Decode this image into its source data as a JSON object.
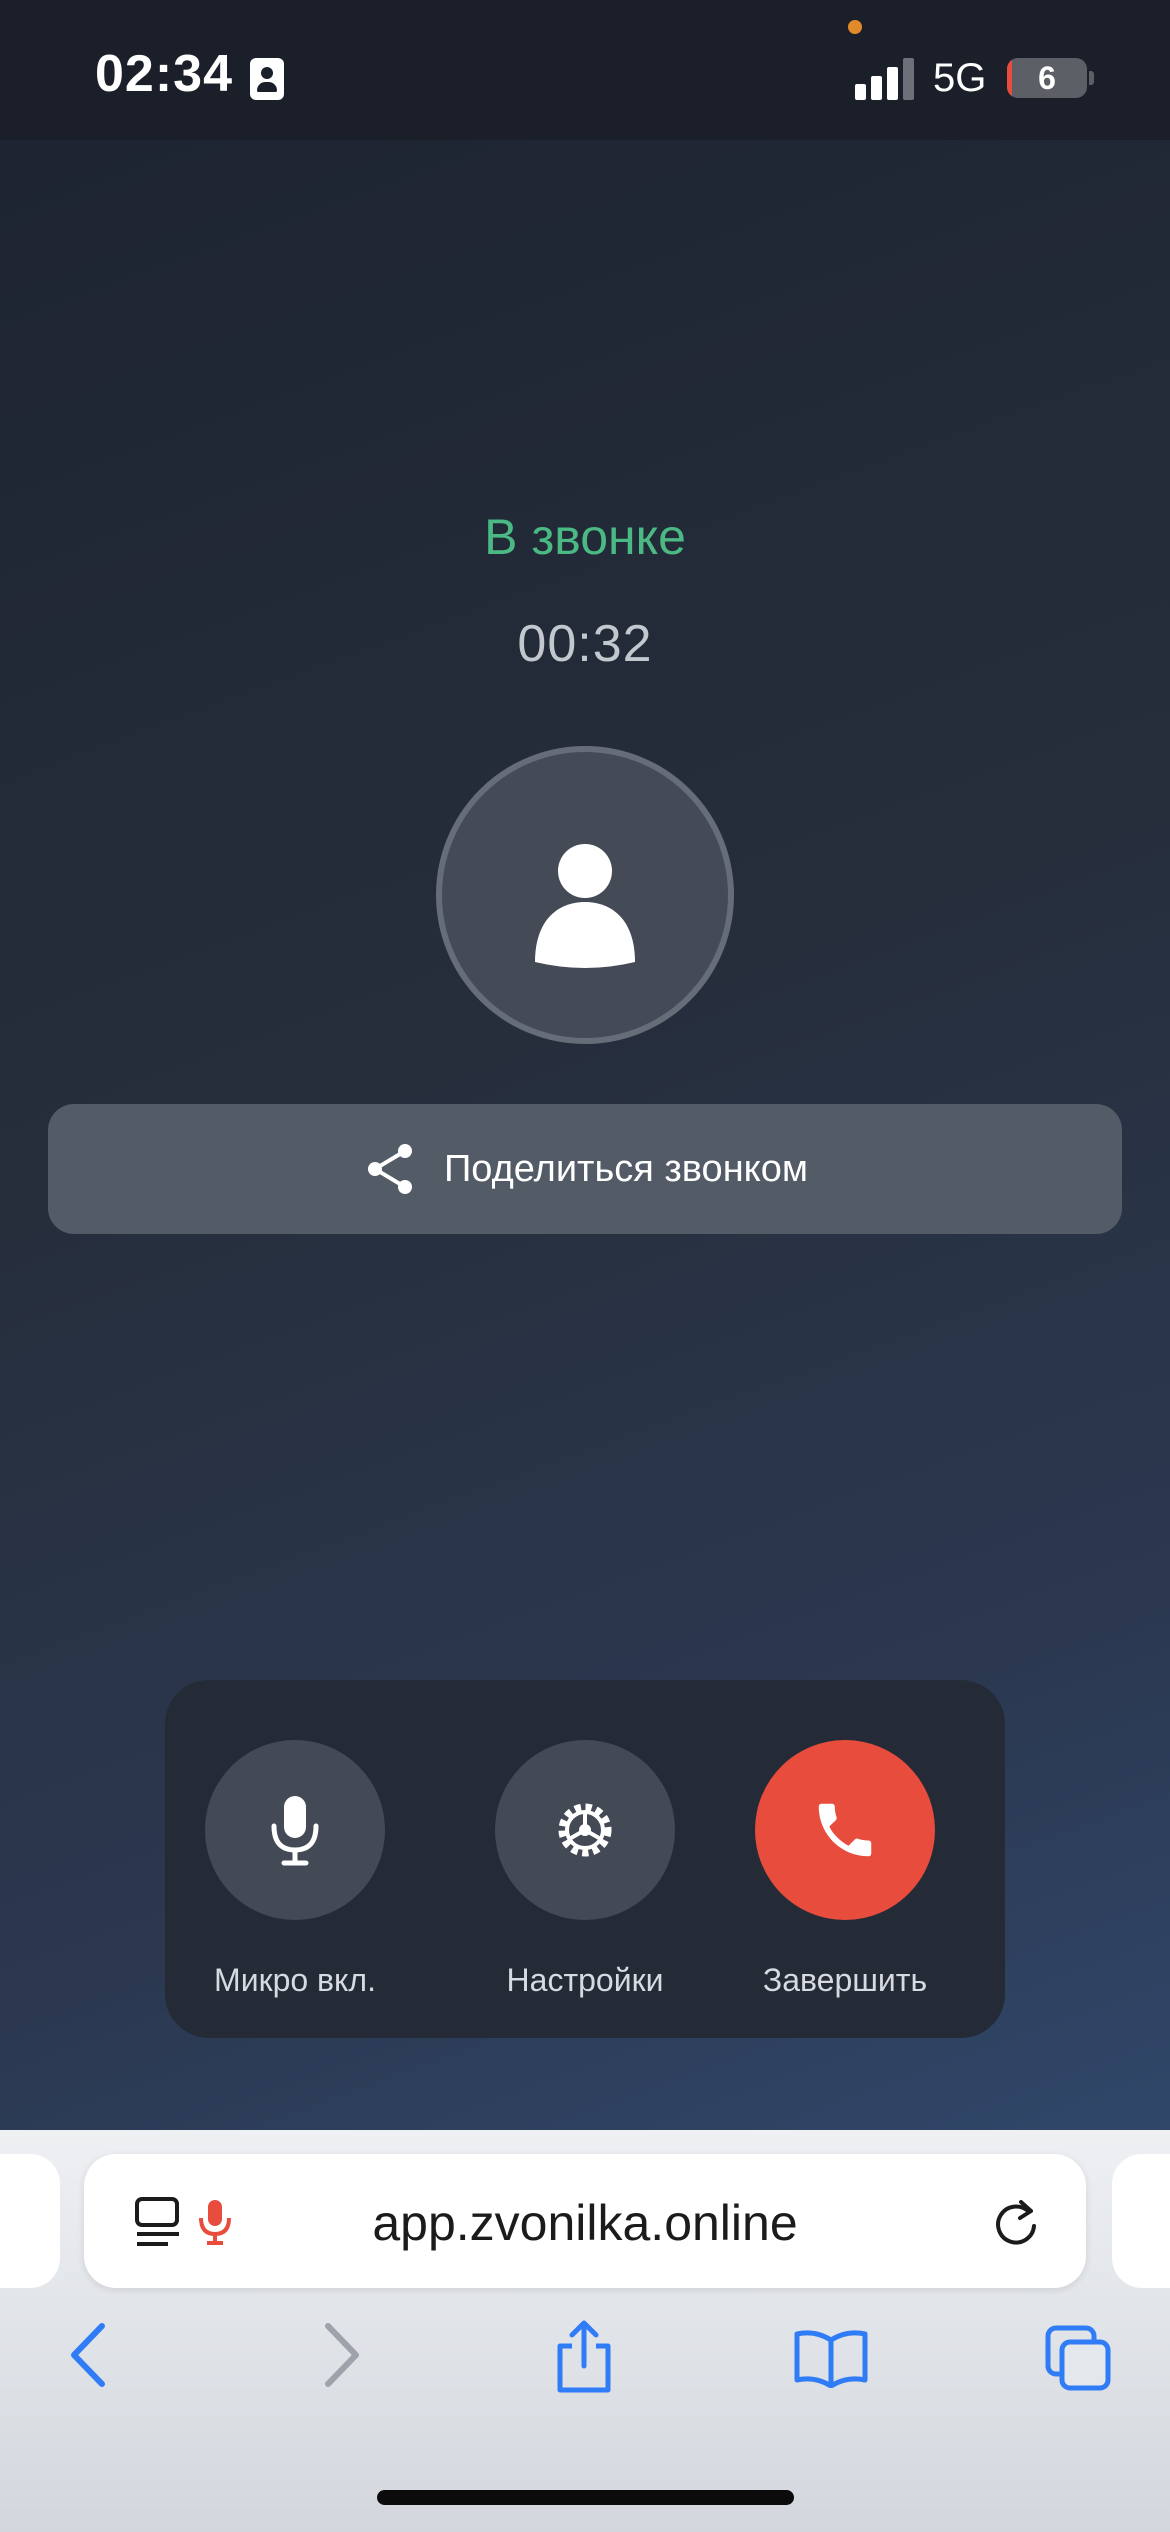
{
  "status_bar": {
    "time": "02:34",
    "network": "5G",
    "battery": "6",
    "battery_percent": 6
  },
  "call": {
    "status": "В звонке",
    "timer": "00:32",
    "share_label": "Поделиться звонком"
  },
  "controls": {
    "mic_label": "Микро вкл.",
    "settings_label": "Настройки",
    "end_label": "Завершить"
  },
  "browser": {
    "url": "app.zvonilka.online"
  },
  "colors": {
    "accent_green": "#4bb983",
    "end_call_red": "#e74c3c",
    "safari_blue": "#2f7cf6"
  },
  "icons": [
    "id-card-icon",
    "signal-icon",
    "battery-icon",
    "person-icon",
    "share-icon",
    "microphone-icon",
    "gear-icon",
    "phone-icon",
    "reader-mode-icon",
    "reload-icon",
    "back-icon",
    "forward-icon",
    "share-sheet-icon",
    "bookmarks-icon",
    "tabs-icon"
  ]
}
